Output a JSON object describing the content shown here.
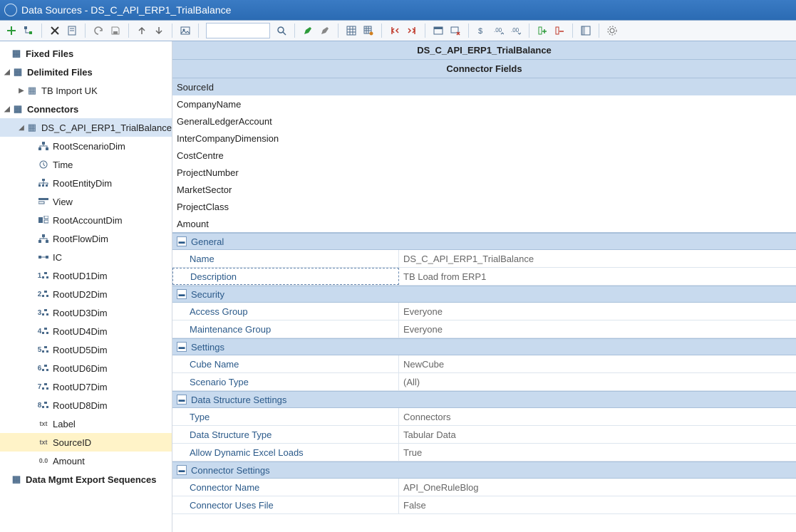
{
  "window": {
    "title": "Data Sources - DS_C_API_ERP1_TrialBalance"
  },
  "toolbar": {
    "search_placeholder": ""
  },
  "tree": {
    "fixed_files": "Fixed Files",
    "delimited_files": "Delimited Files",
    "tb_import_uk": "TB Import UK",
    "connectors": "Connectors",
    "ds_name": "DS_C_API_ERP1_TrialBalance",
    "children": [
      "RootScenarioDim",
      "Time",
      "RootEntityDim",
      "View",
      "RootAccountDim",
      "RootFlowDim",
      "IC",
      "RootUD1Dim",
      "RootUD2Dim",
      "RootUD3Dim",
      "RootUD4Dim",
      "RootUD5Dim",
      "RootUD6Dim",
      "RootUD7Dim",
      "RootUD8Dim",
      "Label",
      "SourceID",
      "Amount"
    ],
    "data_mgmt": "Data Mgmt Export Sequences"
  },
  "content_header": "DS_C_API_ERP1_TrialBalance",
  "fields_header": "Connector Fields",
  "fields": [
    "SourceId",
    "CompanyName",
    "GeneralLedgerAccount",
    "InterCompanyDimension",
    "CostCentre",
    "ProjectNumber",
    "MarketSector",
    "ProjectClass",
    "Amount"
  ],
  "props": {
    "sections": {
      "general": "General",
      "security": "Security",
      "settings": "Settings",
      "dss": "Data Structure Settings",
      "cs": "Connector Settings"
    },
    "general": {
      "name_k": "Name",
      "name_v": "DS_C_API_ERP1_TrialBalance",
      "desc_k": "Description",
      "desc_v": "TB Load from ERP1"
    },
    "security": {
      "ag_k": "Access Group",
      "ag_v": "Everyone",
      "mg_k": "Maintenance Group",
      "mg_v": "Everyone"
    },
    "settings": {
      "cube_k": "Cube Name",
      "cube_v": "NewCube",
      "scen_k": "Scenario Type",
      "scen_v": "(All)"
    },
    "dss": {
      "type_k": "Type",
      "type_v": "Connectors",
      "dst_k": "Data Structure Type",
      "dst_v": "Tabular Data",
      "adel_k": "Allow Dynamic Excel Loads",
      "adel_v": "True"
    },
    "cs": {
      "cn_k": "Connector Name",
      "cn_v": "API_OneRuleBlog",
      "cuf_k": "Connector Uses File",
      "cuf_v": "False"
    }
  }
}
